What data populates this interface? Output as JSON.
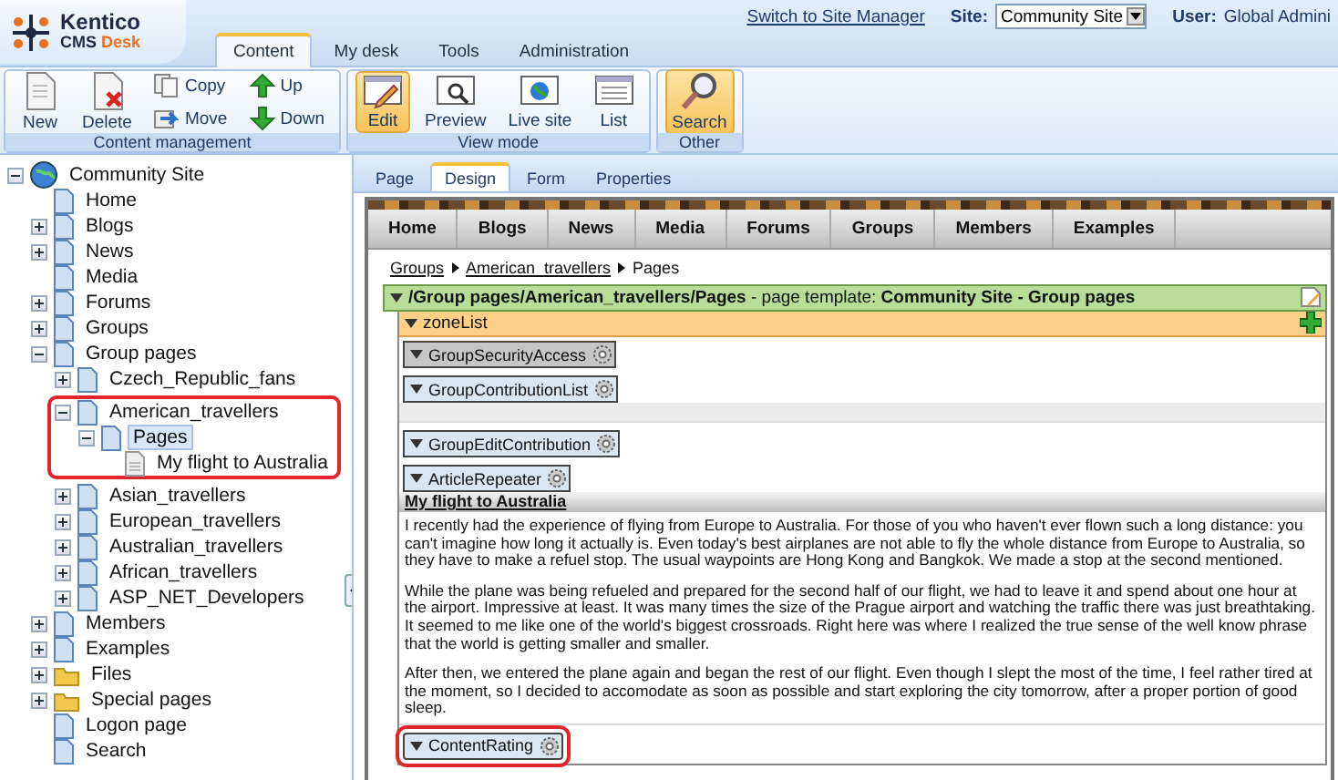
{
  "header": {
    "logo": {
      "name": "Kentico",
      "product": "CMS",
      "edition": "Desk"
    },
    "tabs": [
      {
        "label": "Content",
        "selected": true
      },
      {
        "label": "My desk",
        "selected": false
      },
      {
        "label": "Tools",
        "selected": false
      },
      {
        "label": "Administration",
        "selected": false
      }
    ],
    "switch_link": "Switch to Site Manager",
    "site": {
      "label": "Site:",
      "value": "Community Site"
    },
    "user": {
      "label": "User:",
      "value": "Global Admini"
    }
  },
  "ribbon": [
    {
      "title": "Content management",
      "buttons": [
        {
          "label": "New",
          "kind": "large",
          "selected": false
        },
        {
          "label": "Delete",
          "kind": "large",
          "selected": false
        },
        {
          "label": "Copy",
          "kind": "small",
          "selected": false
        },
        {
          "label": "Move",
          "kind": "small",
          "selected": false
        },
        {
          "label": "Up",
          "kind": "small",
          "selected": false
        },
        {
          "label": "Down",
          "kind": "small",
          "selected": false
        }
      ]
    },
    {
      "title": "View mode",
      "buttons": [
        {
          "label": "Edit",
          "kind": "large",
          "selected": true
        },
        {
          "label": "Preview",
          "kind": "large",
          "selected": false
        },
        {
          "label": "Live site",
          "kind": "large",
          "selected": false
        },
        {
          "label": "List",
          "kind": "large",
          "selected": false
        }
      ]
    },
    {
      "title": "Other",
      "buttons": [
        {
          "label": "Search",
          "kind": "large",
          "selected": true
        }
      ]
    }
  ],
  "tree": {
    "label": "Community Site",
    "kind": "site",
    "expanded": true,
    "selected": false,
    "callout": false,
    "children": [
      {
        "label": "Home",
        "kind": "page",
        "selected": false,
        "callout": false
      },
      {
        "label": "Blogs",
        "kind": "page",
        "expanded": false,
        "selected": false,
        "callout": false
      },
      {
        "label": "News",
        "kind": "page",
        "expanded": false,
        "selected": false,
        "callout": false
      },
      {
        "label": "Media",
        "kind": "page",
        "selected": false,
        "callout": false
      },
      {
        "label": "Forums",
        "kind": "page",
        "expanded": false,
        "selected": false,
        "callout": false
      },
      {
        "label": "Groups",
        "kind": "page",
        "expanded": false,
        "selected": false,
        "callout": false
      },
      {
        "label": "Group pages",
        "kind": "page",
        "expanded": true,
        "selected": false,
        "callout": false,
        "children": [
          {
            "label": "Czech_Republic_fans",
            "kind": "page",
            "expanded": false,
            "selected": false,
            "callout": false
          },
          {
            "label": "American_travellers",
            "kind": "page",
            "expanded": true,
            "selected": false,
            "callout": true,
            "children": [
              {
                "label": "Pages",
                "kind": "page",
                "expanded": true,
                "selected": true,
                "callout": false,
                "children": [
                  {
                    "label": "My flight to Australia",
                    "kind": "document",
                    "selected": false,
                    "callout": false
                  }
                ]
              }
            ]
          },
          {
            "label": "Asian_travellers",
            "kind": "page",
            "expanded": false,
            "selected": false,
            "callout": false
          },
          {
            "label": "European_travellers",
            "kind": "page",
            "expanded": false,
            "selected": false,
            "callout": false
          },
          {
            "label": "Australian_travellers",
            "kind": "page",
            "expanded": false,
            "selected": false,
            "callout": false
          },
          {
            "label": "African_travellers",
            "kind": "page",
            "expanded": false,
            "selected": false,
            "callout": false
          },
          {
            "label": "ASP_NET_Developers",
            "kind": "page",
            "expanded": false,
            "selected": false,
            "callout": false
          }
        ]
      },
      {
        "label": "Members",
        "kind": "page",
        "expanded": false,
        "selected": false,
        "callout": false
      },
      {
        "label": "Examples",
        "kind": "page",
        "expanded": false,
        "selected": false,
        "callout": false
      },
      {
        "label": "Files",
        "kind": "folder",
        "expanded": false,
        "selected": false,
        "callout": false
      },
      {
        "label": "Special pages",
        "kind": "folder",
        "expanded": false,
        "selected": false,
        "callout": false
      },
      {
        "label": "Logon page",
        "kind": "page",
        "selected": false,
        "callout": false
      },
      {
        "label": "Search",
        "kind": "page",
        "selected": false,
        "callout": false
      }
    ]
  },
  "editor": {
    "tabs": [
      {
        "label": "Page",
        "selected": false
      },
      {
        "label": "Design",
        "selected": true
      },
      {
        "label": "Form",
        "selected": false
      },
      {
        "label": "Properties",
        "selected": false
      }
    ],
    "site_menu": [
      "Home",
      "Blogs",
      "News",
      "Media",
      "Forums",
      "Groups",
      "Members",
      "Examples"
    ],
    "breadcrumb": [
      {
        "label": "Groups",
        "link": true
      },
      {
        "label": "American_travellers",
        "link": true
      },
      {
        "label": "Pages",
        "link": false
      }
    ],
    "template_bar": "**/Group pages/American_travellers/Pages** - page template: **Community Site - Group pages**",
    "zone": "zoneList",
    "webparts": [
      {
        "name": "GroupSecurityAccess",
        "kind": "plain",
        "callout": false
      },
      {
        "name": "GroupContributionList",
        "kind": "list",
        "callout": false
      },
      {
        "name": "GroupEditContribution",
        "kind": "plain",
        "callout": false
      },
      {
        "name": "ArticleRepeater",
        "kind": "article",
        "callout": false,
        "article": {
          "title": "My flight to Australia",
          "paragraphs": [
            "I recently had the experience of flying from Europe to Australia. For those of you who haven't ever flown such a long distance: you can't imagine how long it actually is. Even today's best airplanes are not able to fly the whole distance from Europe to Australia, so they have to make a refuel stop. The usual waypoints are Hong Kong and Bangkok. We made a stop at the second mentioned.",
            "While the plane was being refueled and prepared for the second half of our flight, we had to leave it and spend about one hour at the airport. Impressive at least. It was many times the size of the Prague airport and watching the traffic there was just breathtaking. It seemed to me like one of the world's biggest crossroads. Right here was where I realized the true sense of the well know phrase that the world is getting smaller and smaller.",
            "After then, we entered the plane again and began the rest of our flight. Even though I slept the most of the time, I feel rather tired at the moment, so I decided to accomodate as soon as possible and start exploring the city tomorrow, after a proper portion of good sleep."
          ]
        }
      },
      {
        "name": "ContentRating",
        "kind": "plain",
        "callout": true
      }
    ]
  }
}
